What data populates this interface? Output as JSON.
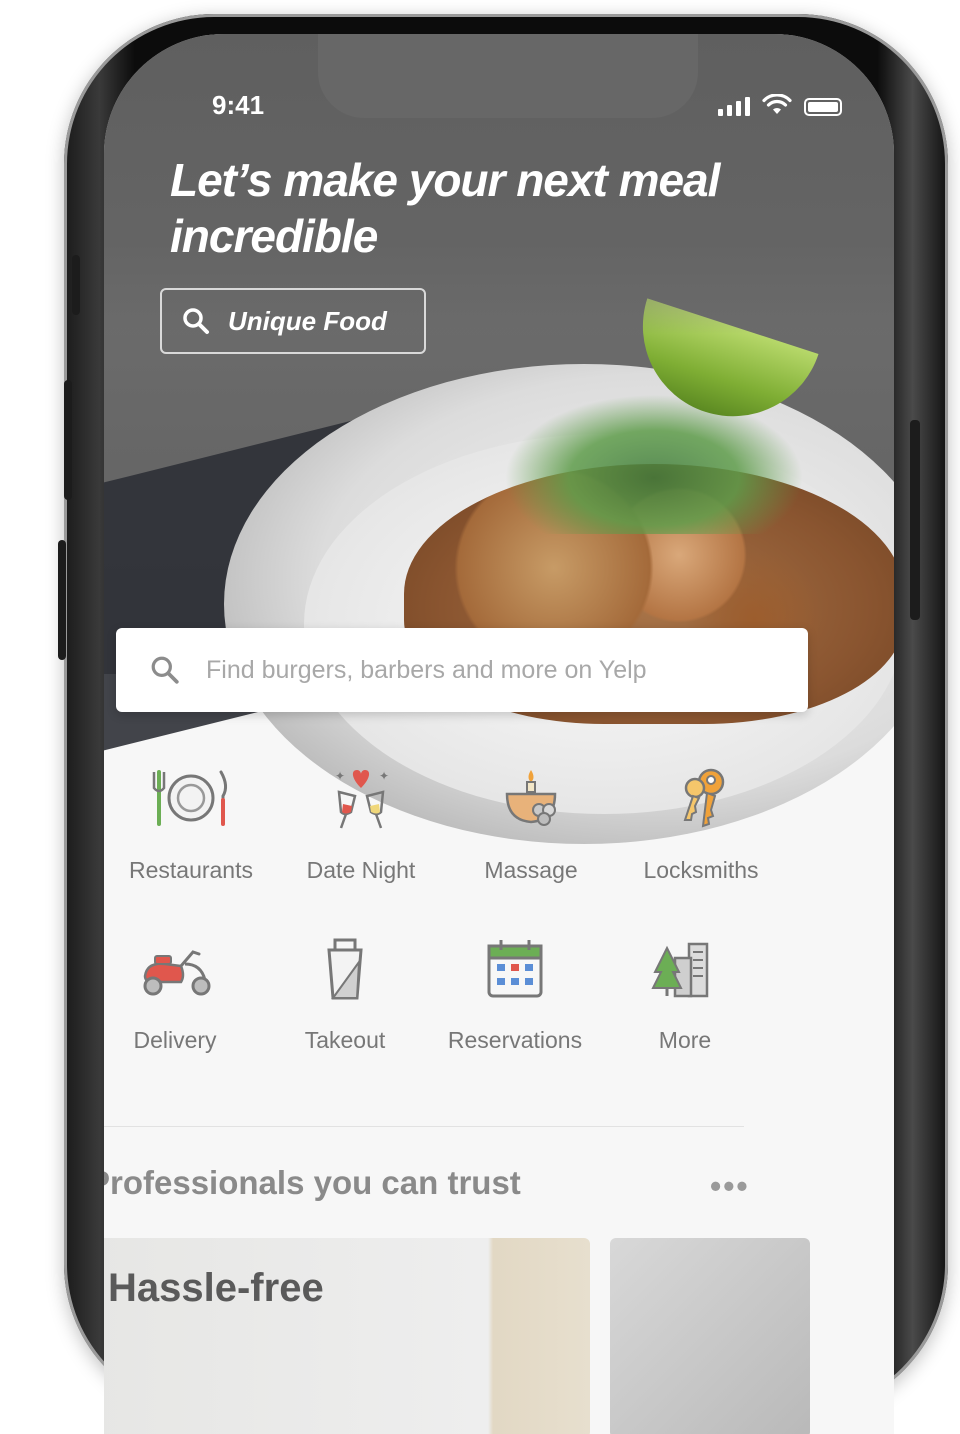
{
  "status_bar": {
    "time": "9:41"
  },
  "hero": {
    "headline": "Let’s make your next meal incredible",
    "tag_label": "Unique Food"
  },
  "search": {
    "placeholder": "Find burgers, barbers and more on Yelp"
  },
  "categories": [
    {
      "label": "Restaurants",
      "icon": "restaurant-icon"
    },
    {
      "label": "Date Night",
      "icon": "date-night-icon"
    },
    {
      "label": "Massage",
      "icon": "massage-icon"
    },
    {
      "label": "Locksmiths",
      "icon": "keys-icon"
    },
    {
      "label": "Delivery",
      "icon": "scooter-icon"
    },
    {
      "label": "Takeout",
      "icon": "takeout-box-icon"
    },
    {
      "label": "Reservations",
      "icon": "calendar-icon"
    },
    {
      "label": "More",
      "icon": "city-icon"
    }
  ],
  "section": {
    "title": "Professionals you can trust",
    "more": "•••",
    "card_text": "Hassle-free"
  },
  "colors": {
    "hero_overlay": "#6a6a6a",
    "icon_red": "#e0574d",
    "icon_orange": "#f0a23a",
    "icon_green": "#6cae55",
    "icon_blue": "#5b8ed6"
  }
}
